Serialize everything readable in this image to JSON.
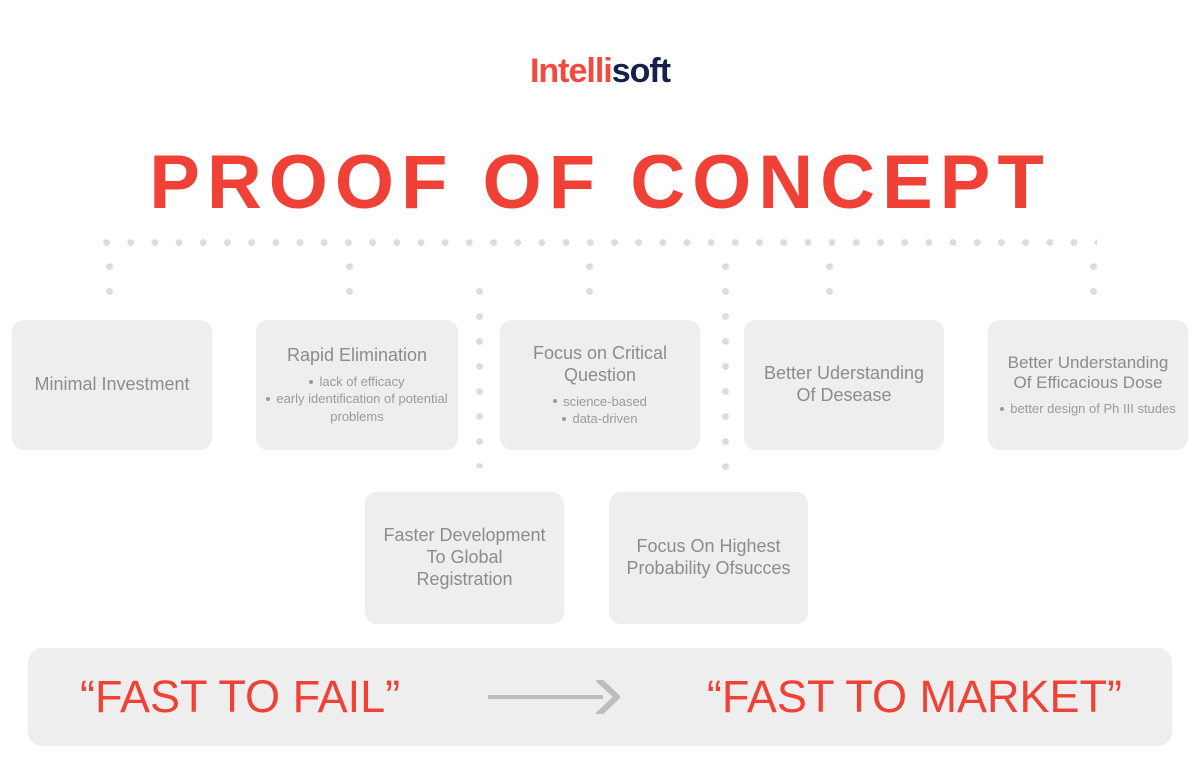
{
  "logo": {
    "part1": "Intelli",
    "part2": "soft",
    "color1": "#f4493c",
    "color2": "#17204a"
  },
  "title": {
    "text": "PROOF OF CONCEPT",
    "color": "#ef4136"
  },
  "theme": {
    "card_bg": "#eeeeee",
    "card_text": "#8c8c8c",
    "dot_color": "#dcdcdc",
    "accent": "#ef4136",
    "arrow_color": "#bdbdbd"
  },
  "cards_row1": [
    {
      "title": "Minimal Investment",
      "bullets": []
    },
    {
      "title": "Rapid Elimination",
      "bullets": [
        "lack of efficacy",
        "early identification of potential problems"
      ]
    },
    {
      "title": "Focus on Critical Question",
      "bullets": [
        "science-based",
        "data-driven"
      ]
    },
    {
      "title": "Better Uderstanding Of Desease",
      "bullets": []
    },
    {
      "title": "Better Understanding Of Efficacious Dose",
      "bullets": [
        "better design of Ph III studes"
      ]
    }
  ],
  "cards_row2": [
    {
      "title": "Faster Development To Global Registration",
      "bullets": []
    },
    {
      "title": "Focus On Highest Probability Ofsucces",
      "bullets": []
    }
  ],
  "banner": {
    "left": "“FAST TO FAIL”",
    "right": "“FAST TO MARKET”",
    "arrow": "arrow-right"
  }
}
